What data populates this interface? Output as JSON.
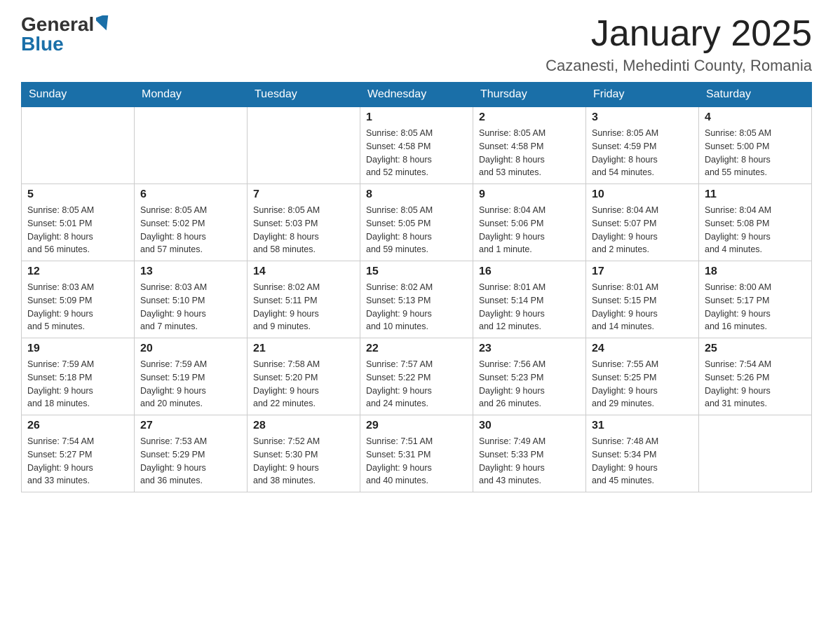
{
  "header": {
    "logo_general": "General",
    "logo_blue": "Blue",
    "month_title": "January 2025",
    "location": "Cazanesti, Mehedinti County, Romania"
  },
  "weekdays": [
    "Sunday",
    "Monday",
    "Tuesday",
    "Wednesday",
    "Thursday",
    "Friday",
    "Saturday"
  ],
  "weeks": [
    [
      {
        "day": "",
        "info": ""
      },
      {
        "day": "",
        "info": ""
      },
      {
        "day": "",
        "info": ""
      },
      {
        "day": "1",
        "info": "Sunrise: 8:05 AM\nSunset: 4:58 PM\nDaylight: 8 hours\nand 52 minutes."
      },
      {
        "day": "2",
        "info": "Sunrise: 8:05 AM\nSunset: 4:58 PM\nDaylight: 8 hours\nand 53 minutes."
      },
      {
        "day": "3",
        "info": "Sunrise: 8:05 AM\nSunset: 4:59 PM\nDaylight: 8 hours\nand 54 minutes."
      },
      {
        "day": "4",
        "info": "Sunrise: 8:05 AM\nSunset: 5:00 PM\nDaylight: 8 hours\nand 55 minutes."
      }
    ],
    [
      {
        "day": "5",
        "info": "Sunrise: 8:05 AM\nSunset: 5:01 PM\nDaylight: 8 hours\nand 56 minutes."
      },
      {
        "day": "6",
        "info": "Sunrise: 8:05 AM\nSunset: 5:02 PM\nDaylight: 8 hours\nand 57 minutes."
      },
      {
        "day": "7",
        "info": "Sunrise: 8:05 AM\nSunset: 5:03 PM\nDaylight: 8 hours\nand 58 minutes."
      },
      {
        "day": "8",
        "info": "Sunrise: 8:05 AM\nSunset: 5:05 PM\nDaylight: 8 hours\nand 59 minutes."
      },
      {
        "day": "9",
        "info": "Sunrise: 8:04 AM\nSunset: 5:06 PM\nDaylight: 9 hours\nand 1 minute."
      },
      {
        "day": "10",
        "info": "Sunrise: 8:04 AM\nSunset: 5:07 PM\nDaylight: 9 hours\nand 2 minutes."
      },
      {
        "day": "11",
        "info": "Sunrise: 8:04 AM\nSunset: 5:08 PM\nDaylight: 9 hours\nand 4 minutes."
      }
    ],
    [
      {
        "day": "12",
        "info": "Sunrise: 8:03 AM\nSunset: 5:09 PM\nDaylight: 9 hours\nand 5 minutes."
      },
      {
        "day": "13",
        "info": "Sunrise: 8:03 AM\nSunset: 5:10 PM\nDaylight: 9 hours\nand 7 minutes."
      },
      {
        "day": "14",
        "info": "Sunrise: 8:02 AM\nSunset: 5:11 PM\nDaylight: 9 hours\nand 9 minutes."
      },
      {
        "day": "15",
        "info": "Sunrise: 8:02 AM\nSunset: 5:13 PM\nDaylight: 9 hours\nand 10 minutes."
      },
      {
        "day": "16",
        "info": "Sunrise: 8:01 AM\nSunset: 5:14 PM\nDaylight: 9 hours\nand 12 minutes."
      },
      {
        "day": "17",
        "info": "Sunrise: 8:01 AM\nSunset: 5:15 PM\nDaylight: 9 hours\nand 14 minutes."
      },
      {
        "day": "18",
        "info": "Sunrise: 8:00 AM\nSunset: 5:17 PM\nDaylight: 9 hours\nand 16 minutes."
      }
    ],
    [
      {
        "day": "19",
        "info": "Sunrise: 7:59 AM\nSunset: 5:18 PM\nDaylight: 9 hours\nand 18 minutes."
      },
      {
        "day": "20",
        "info": "Sunrise: 7:59 AM\nSunset: 5:19 PM\nDaylight: 9 hours\nand 20 minutes."
      },
      {
        "day": "21",
        "info": "Sunrise: 7:58 AM\nSunset: 5:20 PM\nDaylight: 9 hours\nand 22 minutes."
      },
      {
        "day": "22",
        "info": "Sunrise: 7:57 AM\nSunset: 5:22 PM\nDaylight: 9 hours\nand 24 minutes."
      },
      {
        "day": "23",
        "info": "Sunrise: 7:56 AM\nSunset: 5:23 PM\nDaylight: 9 hours\nand 26 minutes."
      },
      {
        "day": "24",
        "info": "Sunrise: 7:55 AM\nSunset: 5:25 PM\nDaylight: 9 hours\nand 29 minutes."
      },
      {
        "day": "25",
        "info": "Sunrise: 7:54 AM\nSunset: 5:26 PM\nDaylight: 9 hours\nand 31 minutes."
      }
    ],
    [
      {
        "day": "26",
        "info": "Sunrise: 7:54 AM\nSunset: 5:27 PM\nDaylight: 9 hours\nand 33 minutes."
      },
      {
        "day": "27",
        "info": "Sunrise: 7:53 AM\nSunset: 5:29 PM\nDaylight: 9 hours\nand 36 minutes."
      },
      {
        "day": "28",
        "info": "Sunrise: 7:52 AM\nSunset: 5:30 PM\nDaylight: 9 hours\nand 38 minutes."
      },
      {
        "day": "29",
        "info": "Sunrise: 7:51 AM\nSunset: 5:31 PM\nDaylight: 9 hours\nand 40 minutes."
      },
      {
        "day": "30",
        "info": "Sunrise: 7:49 AM\nSunset: 5:33 PM\nDaylight: 9 hours\nand 43 minutes."
      },
      {
        "day": "31",
        "info": "Sunrise: 7:48 AM\nSunset: 5:34 PM\nDaylight: 9 hours\nand 45 minutes."
      },
      {
        "day": "",
        "info": ""
      }
    ]
  ]
}
